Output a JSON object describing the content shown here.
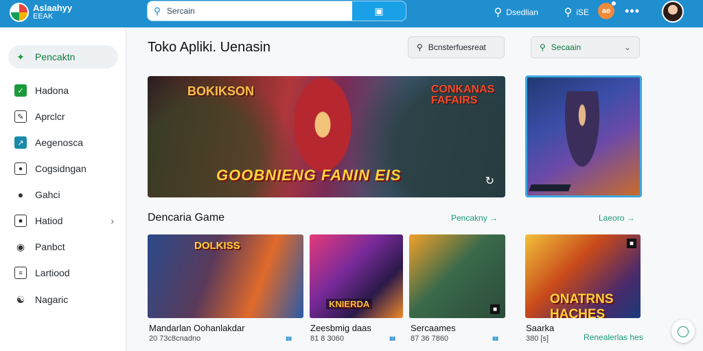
{
  "app": {
    "name_line1": "Aslaahyy",
    "name_line2": "EEAK"
  },
  "search": {
    "text": "Sercain",
    "icon": "search-icon",
    "button_icon": "bookmark-icon"
  },
  "header_right": {
    "search_label": "Dsedlian",
    "extra_text": "iSE",
    "badge_text": "ae"
  },
  "sidebar": {
    "items": [
      {
        "label": "Pencaktn",
        "icon": "controller-icon",
        "color": "#1a9a3a"
      },
      {
        "label": "Hadona",
        "icon": "home-icon",
        "color": "#1a9a3a"
      },
      {
        "label": "Aprclcr",
        "icon": "edit-icon",
        "color": "#333333"
      },
      {
        "label": "Aegenosca",
        "icon": "chart-icon",
        "color": "#1a8aa8"
      },
      {
        "label": "Cogsidngan",
        "icon": "image-icon",
        "color": "#333333"
      },
      {
        "label": "Gahci",
        "icon": "pin-icon",
        "color": "#333333"
      },
      {
        "label": "Hatiod",
        "icon": "folder-icon",
        "color": "#333333"
      },
      {
        "label": "Panbct",
        "icon": "location-icon",
        "color": "#333333"
      },
      {
        "label": "Lartiood",
        "icon": "document-icon",
        "color": "#333333"
      },
      {
        "label": "Nagaric",
        "icon": "user-icon",
        "color": "#333333"
      }
    ]
  },
  "main": {
    "title": "Toko Apliki. Uenasin",
    "filter_label": "Bcnsterfuesreat",
    "sort_label": "Secaain",
    "hero": {
      "title_left": "BOKIKSON",
      "title_right_1": "CONKANAS",
      "title_right_2": "FAFAIRS",
      "banner": "GOOBNIENG FANIN EIS"
    },
    "section_title": "Dencaria Game",
    "section_link": "Pencakny →",
    "section_link2": "Laeoro →",
    "cards": [
      {
        "art_text": "DOLKISS",
        "title": "Mandarlan Oohanlakdar",
        "sub": "20 73c8cnadno",
        "bars": "ıııı"
      },
      {
        "art_text": "KNIERDA",
        "title": "Zeesbmig daas",
        "sub": "81 8 3060",
        "bars": "ıııı"
      },
      {
        "art_text": "",
        "title": "Sercaames",
        "sub": "87 36 7860",
        "bars": "ıııı"
      },
      {
        "art_text": "ONATRNS HACHES",
        "title": "Saarka",
        "sub": "380 [s]",
        "bars": ""
      }
    ],
    "more_link": "Renealerlas hes"
  }
}
